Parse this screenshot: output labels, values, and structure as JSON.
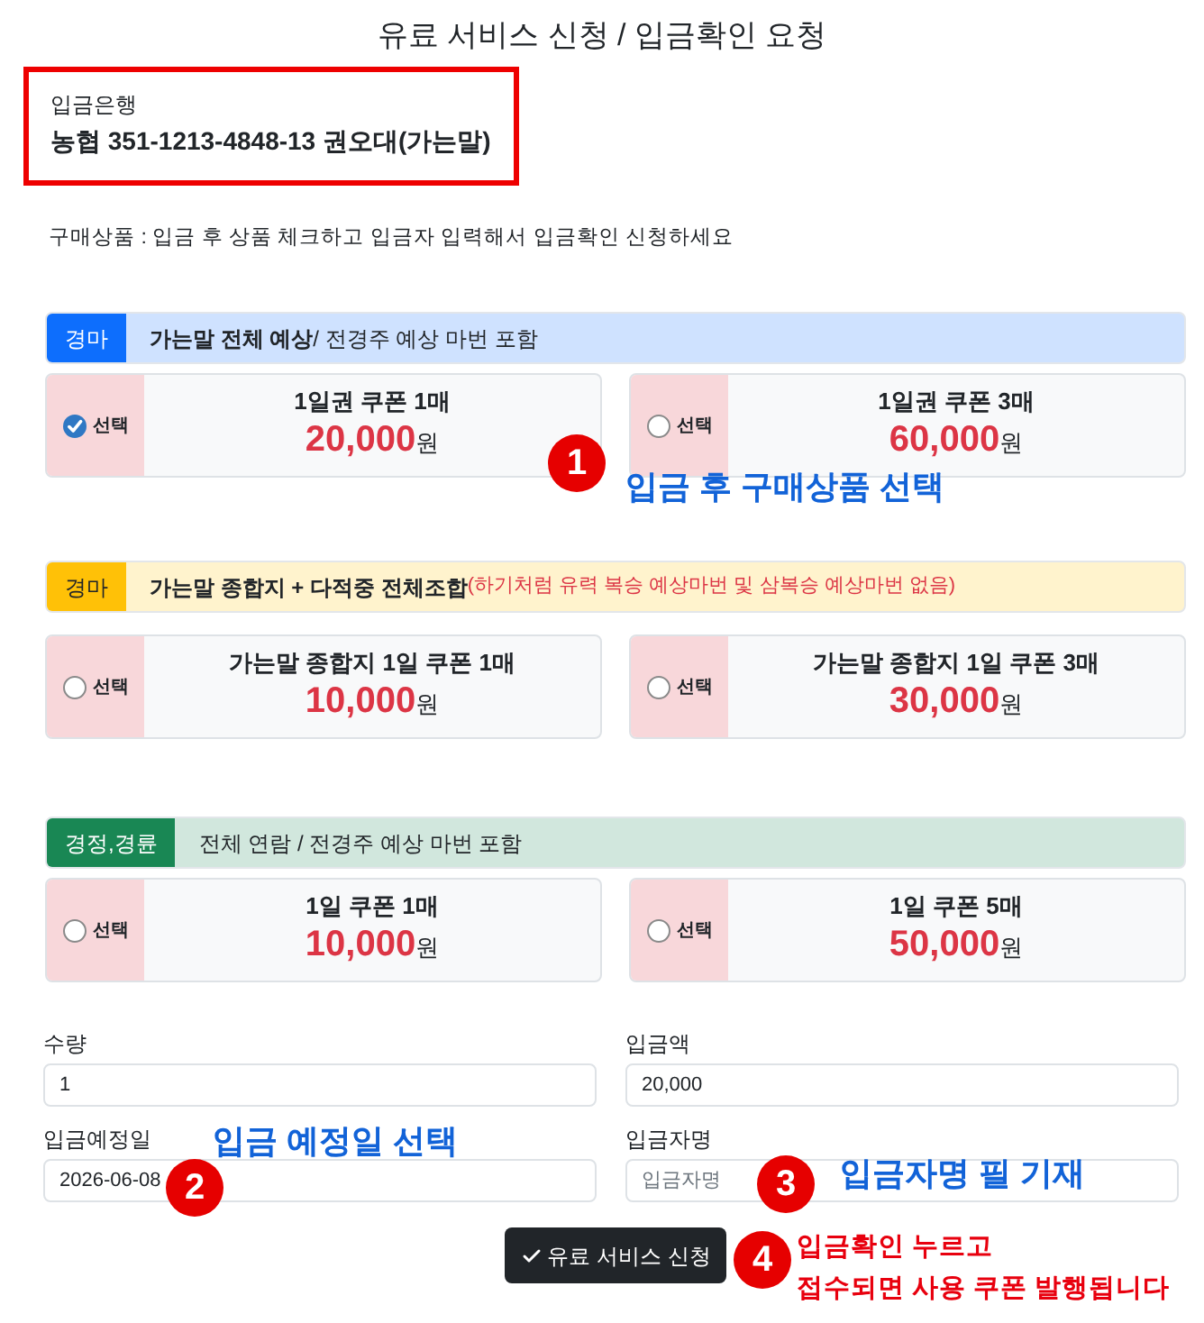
{
  "title": "유료 서비스 신청 / 입금확인 요청",
  "bank": {
    "label": "입금은행",
    "account": "농협 351-1213-4848-13 권오대(가는말)"
  },
  "instruction": "구매상품 : 입금 후 상품 체크하고 입금자 입력해서 입금확인 신청하세요",
  "sections": [
    {
      "badge": "경마",
      "color": "#0d6efd",
      "heading": "**가는말 전체 예상**/ 전경주 예상 마번 포함",
      "products": [
        {
          "choose_label": "선택",
          "selected": true,
          "title": "1일권 쿠폰 1매",
          "price": "20,000",
          "unit": "원"
        },
        {
          "choose_label": "선택",
          "selected": false,
          "title": "1일권 쿠폰 3매",
          "price": "60,000",
          "unit": "원"
        }
      ]
    },
    {
      "badge": "경마",
      "color": "#ffc107",
      "heading": "**가는말 종합지 + 다적중 전체조합**",
      "note": "(하기처럼 유력 복승 예상마번 및 삼복승 예상마번 없음)",
      "products": [
        {
          "choose_label": "선택",
          "selected": false,
          "title": "가는말 종합지 1일 쿠폰 1매",
          "price": "10,000",
          "unit": "원"
        },
        {
          "choose_label": "선택",
          "selected": false,
          "title": "가는말 종합지 1일 쿠폰 3매",
          "price": "30,000",
          "unit": "원"
        }
      ]
    },
    {
      "badge": "경정,경륜",
      "color": "#198754",
      "heading": "전체 연람 / 전경주 예상 마번 포함",
      "products": [
        {
          "choose_label": "선택",
          "selected": false,
          "title": "1일 쿠폰 1매",
          "price": "10,000",
          "unit": "원"
        },
        {
          "choose_label": "선택",
          "selected": false,
          "title": "1일 쿠폰 5매",
          "price": "50,000",
          "unit": "원"
        }
      ]
    }
  ],
  "form": {
    "fields": [
      {
        "label": "수량",
        "value": "1"
      },
      {
        "label": "입금액",
        "value": "20,000"
      },
      {
        "label": "입금예정일",
        "value": "2026-06-08"
      },
      {
        "label": "입금자명",
        "placeholder": "입금자명"
      }
    ],
    "submit": "유료 서비스 신청"
  },
  "annotations": [
    {
      "number": "1",
      "lines": [
        "입금 후 구매상품 선택"
      ],
      "color": "#1263d8"
    },
    {
      "number": "2",
      "lines": [
        "입금 예정일 선택"
      ],
      "color": "#1263d8"
    },
    {
      "number": "3",
      "lines": [
        "입금자명 필 기재"
      ],
      "color": "#1263d8"
    },
    {
      "number": "4",
      "lines": [
        "입금확인 누르고",
        "접수되면 사용 쿠폰 발행됩니다"
      ],
      "color": "#e8000e"
    }
  ]
}
